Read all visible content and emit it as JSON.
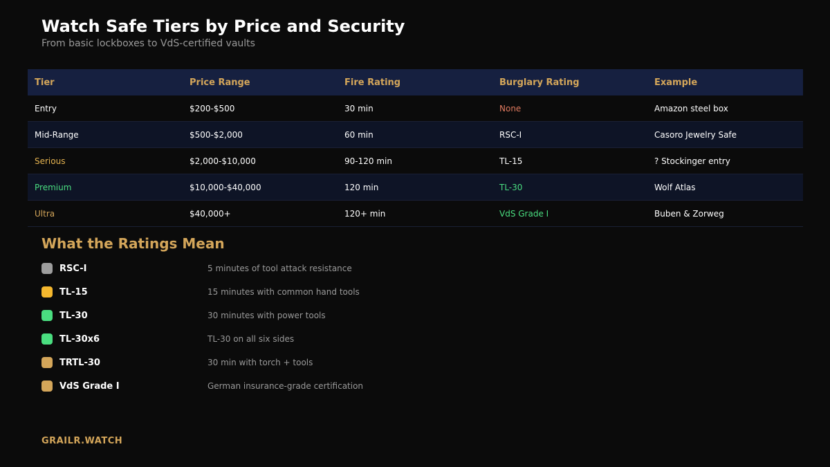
{
  "header": {
    "title": "Watch Safe Tiers by Price and Security",
    "subtitle": "From basic lockboxes to VdS-certified vaults"
  },
  "table": {
    "columns": [
      "Tier",
      "Price Range",
      "Fire Rating",
      "Burglary Rating",
      "Example"
    ],
    "rows": [
      [
        "Entry",
        "$200-$500",
        "30 min",
        "None",
        "Amazon steel box"
      ],
      [
        "Mid-Range",
        "$500-$2,000",
        "60 min",
        "RSC-I",
        "Casoro Jewelry Safe"
      ],
      [
        "Serious",
        "$2,000-$10,000",
        "90-120 min",
        "TL-15",
        "? Stockinger entry"
      ],
      [
        "Premium",
        "$10,000-$40,000",
        "120 min",
        "TL-30",
        "Wolf Atlas"
      ],
      [
        "Ultra",
        "$40,000+",
        "120+ min",
        "VdS Grade I",
        "Buben & Zorweg"
      ]
    ]
  },
  "ratings": {
    "title": "What the Ratings Mean",
    "items": [
      {
        "name": "RSC-I",
        "description": "5 minutes of tool attack resistance",
        "color": "#9e9e9e"
      },
      {
        "name": "TL-15",
        "description": "15 minutes with common hand tools",
        "color": "#f5b82e"
      },
      {
        "name": "TL-30",
        "description": "30 minutes with power tools",
        "color": "#4ade80"
      },
      {
        "name": "TL-30x6",
        "description": "TL-30 on all six sides",
        "color": "#4ade80"
      },
      {
        "name": "TRTL-30",
        "description": "30 min with torch + tools",
        "color": "#d4a65a"
      },
      {
        "name": "VdS Grade I",
        "description": "German insurance-grade certification",
        "color": "#d4a65a"
      }
    ]
  },
  "footer": {
    "brand": "GRAILR.WATCH"
  },
  "colors": {
    "background": "#0b0b0b",
    "accent_gold": "#d4a65a",
    "green": "#4ade80",
    "red": "#e07a5f",
    "header_row": "#162040"
  }
}
